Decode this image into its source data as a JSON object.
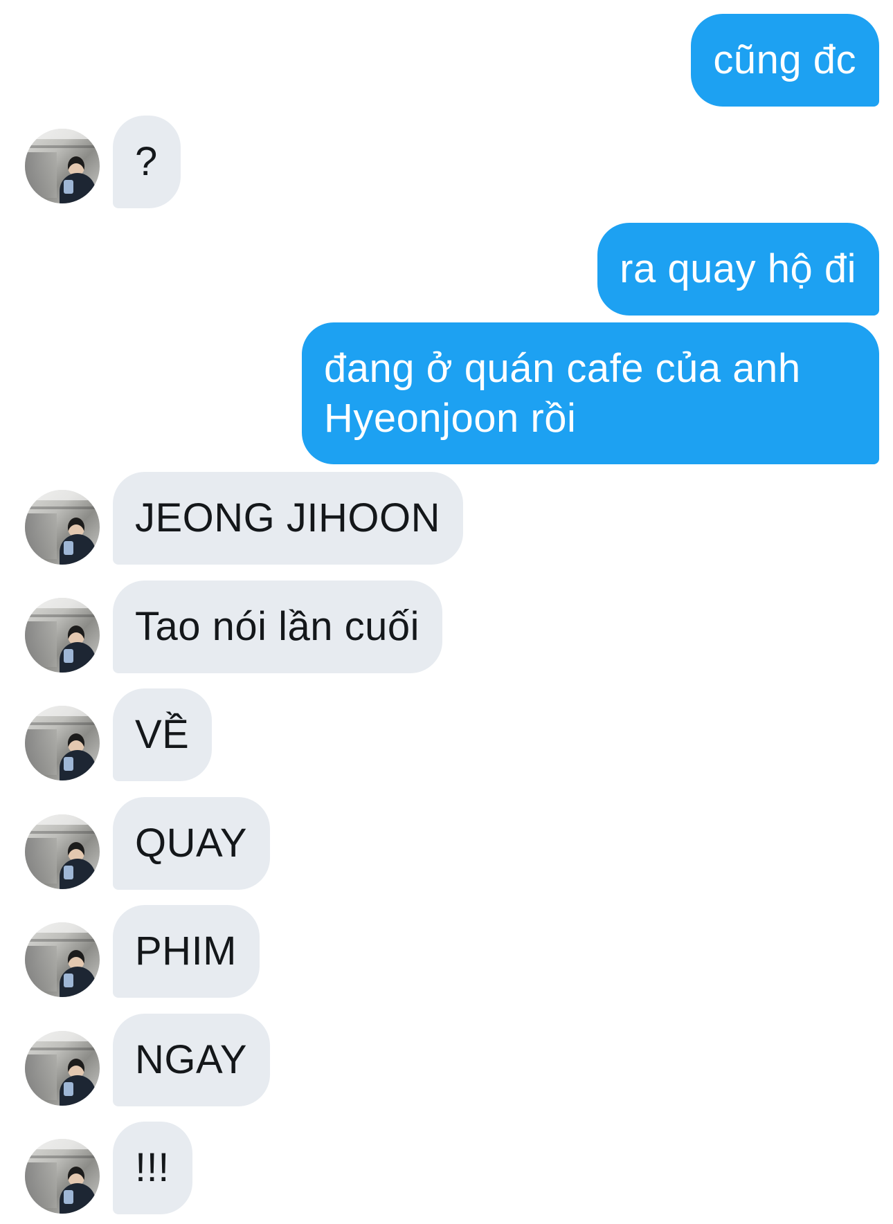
{
  "conversation": {
    "messages": [
      {
        "id": "m1",
        "direction": "sent",
        "text": "cũng đc"
      },
      {
        "id": "m2",
        "direction": "received",
        "text": "?"
      },
      {
        "id": "m3",
        "direction": "sent",
        "text": "ra quay hộ đi"
      },
      {
        "id": "m4",
        "direction": "sent",
        "text": "đang ở quán cafe của anh Hyeonjoon rồi"
      },
      {
        "id": "m5",
        "direction": "received",
        "text": "JEONG JIHOON"
      },
      {
        "id": "m6",
        "direction": "received",
        "text": "Tao nói lần cuối"
      },
      {
        "id": "m7",
        "direction": "received",
        "text": "VỀ"
      },
      {
        "id": "m8",
        "direction": "received",
        "text": "QUAY"
      },
      {
        "id": "m9",
        "direction": "received",
        "text": "PHIM"
      },
      {
        "id": "m10",
        "direction": "received",
        "text": "NGAY"
      },
      {
        "id": "m11",
        "direction": "received",
        "text": "!!!"
      }
    ]
  },
  "colors": {
    "sent_bubble": "#1da1f2",
    "sent_text": "#ffffff",
    "received_bubble": "#e7ebf0",
    "received_text": "#14171a",
    "background": "#ffffff"
  },
  "icons": {
    "avatar": "contact-avatar-photo"
  }
}
